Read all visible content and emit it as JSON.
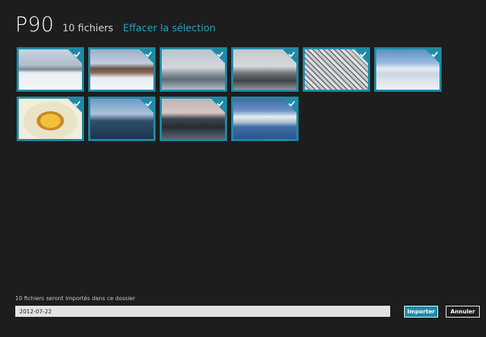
{
  "header": {
    "title": "P90",
    "count": "10 fichiers",
    "clear_selection": "Effacer la sélection"
  },
  "thumbnails": [
    {
      "id": 1,
      "selected": true,
      "icon": "checkmark-icon"
    },
    {
      "id": 2,
      "selected": true,
      "icon": "checkmark-icon"
    },
    {
      "id": 3,
      "selected": true,
      "icon": "checkmark-icon"
    },
    {
      "id": 4,
      "selected": true,
      "icon": "checkmark-icon"
    },
    {
      "id": 5,
      "selected": true,
      "icon": "checkmark-icon"
    },
    {
      "id": 6,
      "selected": true,
      "icon": "checkmark-icon"
    },
    {
      "id": 7,
      "selected": true,
      "icon": "checkmark-icon"
    },
    {
      "id": 8,
      "selected": true,
      "icon": "checkmark-icon"
    },
    {
      "id": 9,
      "selected": true,
      "icon": "checkmark-icon"
    },
    {
      "id": 10,
      "selected": true,
      "icon": "checkmark-icon"
    }
  ],
  "footer": {
    "label": "10 fichiers seront importés dans ce dossier",
    "folder_value": "2012-07-22",
    "import_label": "Importer",
    "cancel_label": "Annuler"
  },
  "colors": {
    "background": "#1d1d1d",
    "accent": "#1e8aa6",
    "link": "#2a9fb5"
  }
}
